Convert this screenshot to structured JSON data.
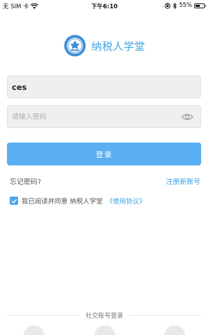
{
  "status_bar": {
    "carrier": "无 SIM 卡",
    "time": "下午6:10",
    "battery": "55%",
    "battery_level": 0.55
  },
  "brand": {
    "title": "纳税人学堂",
    "logo_icon": "school-seal-logo",
    "color": "#3aa3e3"
  },
  "login_form": {
    "username_value": "ces",
    "password_placeholder": "请输入密码",
    "password_toggle_icon": "eye-icon",
    "submit_label": "登录",
    "submit_color": "#5aaef2"
  },
  "links": {
    "forgot_password": "忘记密码?",
    "register": "注册新账号"
  },
  "agreement": {
    "checked": true,
    "text": "我已阅读并同意 纳税人学堂",
    "link_text": "《使用协议》"
  },
  "social": {
    "label": "社交账号登录",
    "icons": [
      "social-login-icon",
      "social-login-icon",
      "social-login-icon"
    ]
  }
}
